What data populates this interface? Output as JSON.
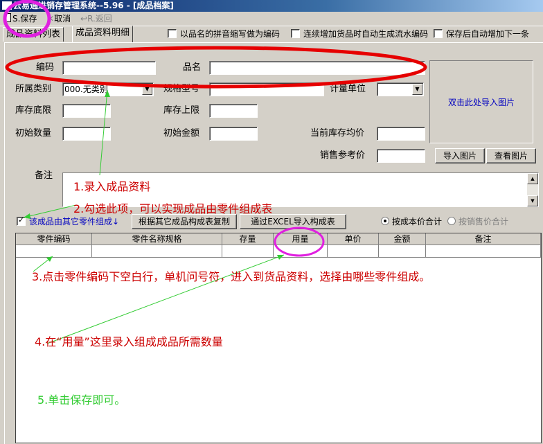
{
  "window": {
    "title": "云易通进销存管理系统--5.96 - [成品档案]"
  },
  "toolbar": {
    "save": "S.保存",
    "cancel": "取消",
    "back": "R.返回"
  },
  "tabs": [
    "成品资料列表",
    "成品资料明细"
  ],
  "options": [
    {
      "label": "以品名的拼音缩写做为编码",
      "checked": false
    },
    {
      "label": "连续增加货品时自动生成流水编码",
      "checked": false
    },
    {
      "label": "保存后自动增加下一条",
      "checked": false
    }
  ],
  "form": {
    "code_label": "编码",
    "code_value": "",
    "name_label": "品名",
    "name_value": "",
    "category_label": "所属类别",
    "category_value": "000.无类别",
    "spec_label": "规格型号",
    "spec_value": "",
    "unit_label": "计量单位",
    "unit_value": "",
    "min_stock_label": "库存底限",
    "min_stock_value": "",
    "max_stock_label": "库存上限",
    "max_stock_value": "",
    "init_qty_label": "初始数量",
    "init_qty_value": "",
    "init_amount_label": "初始金额",
    "init_amount_value": "",
    "avg_price_label": "当前库存均价",
    "avg_price_value": "",
    "sale_price_label": "销售参考价",
    "sale_price_value": "",
    "remark_label": "备注"
  },
  "image": {
    "hint": "双击此处导入图片",
    "import_btn": "导入图片",
    "view_btn": "查看图片"
  },
  "components": {
    "checkbox_label": "该成品由其它零件组成↓",
    "checked": true,
    "copy_btn": "根据其它成品构成表复制",
    "excel_btn": "通过EXCEL导入构成表",
    "radio_cost": "按成本价合计",
    "radio_cost_selected": true,
    "radio_sale": "按销售价合计"
  },
  "grid": {
    "columns": [
      "零件编码",
      "零件名称规格",
      "存量",
      "用量",
      "单价",
      "金额",
      "备注"
    ]
  },
  "annotations": [
    "1.录入成品资料",
    "2.勾选此项，可以实现成品由零件组成表",
    "3.点击零件编码下空白行，单机问号符，进入到货品资料，选择由哪些零件组成。",
    "4.在“用量”这里录入组成成品所需数量",
    "5.单击保存即可。"
  ],
  "colors": {
    "annotation_red": "#cc0000",
    "annotation_green": "#33cc33",
    "oval_red": "#e60000",
    "circle_magenta": "#e020e0",
    "hint_blue": "#0000c0"
  }
}
